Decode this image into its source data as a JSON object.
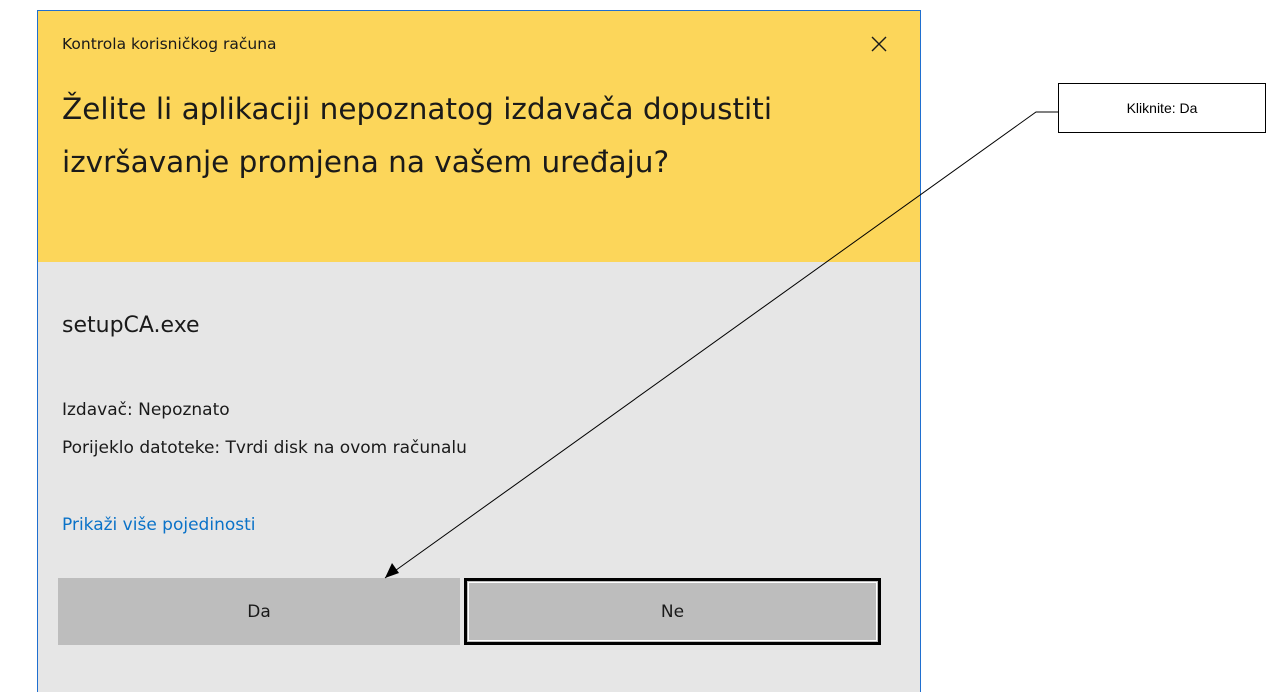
{
  "dialog": {
    "caption": "Kontrola korisničkog računa",
    "question": "Želite li aplikaciji nepoznatog izdavača dopustiti izvršavanje promjena na vašem uređaju?",
    "program_name": "setupCA.exe",
    "publisher": "Izdavač: Nepoznato",
    "file_origin": "Porijeklo datoteke: Tvrdi disk na ovom računalu",
    "details_link": "Prikaži više pojedinosti",
    "yes_label": "Da",
    "no_label": "Ne",
    "close_icon": "close-icon",
    "header_color": "#fcd65a",
    "link_color": "#0a72c8"
  },
  "annotation": {
    "callout_text": "Kliknite: Da"
  }
}
